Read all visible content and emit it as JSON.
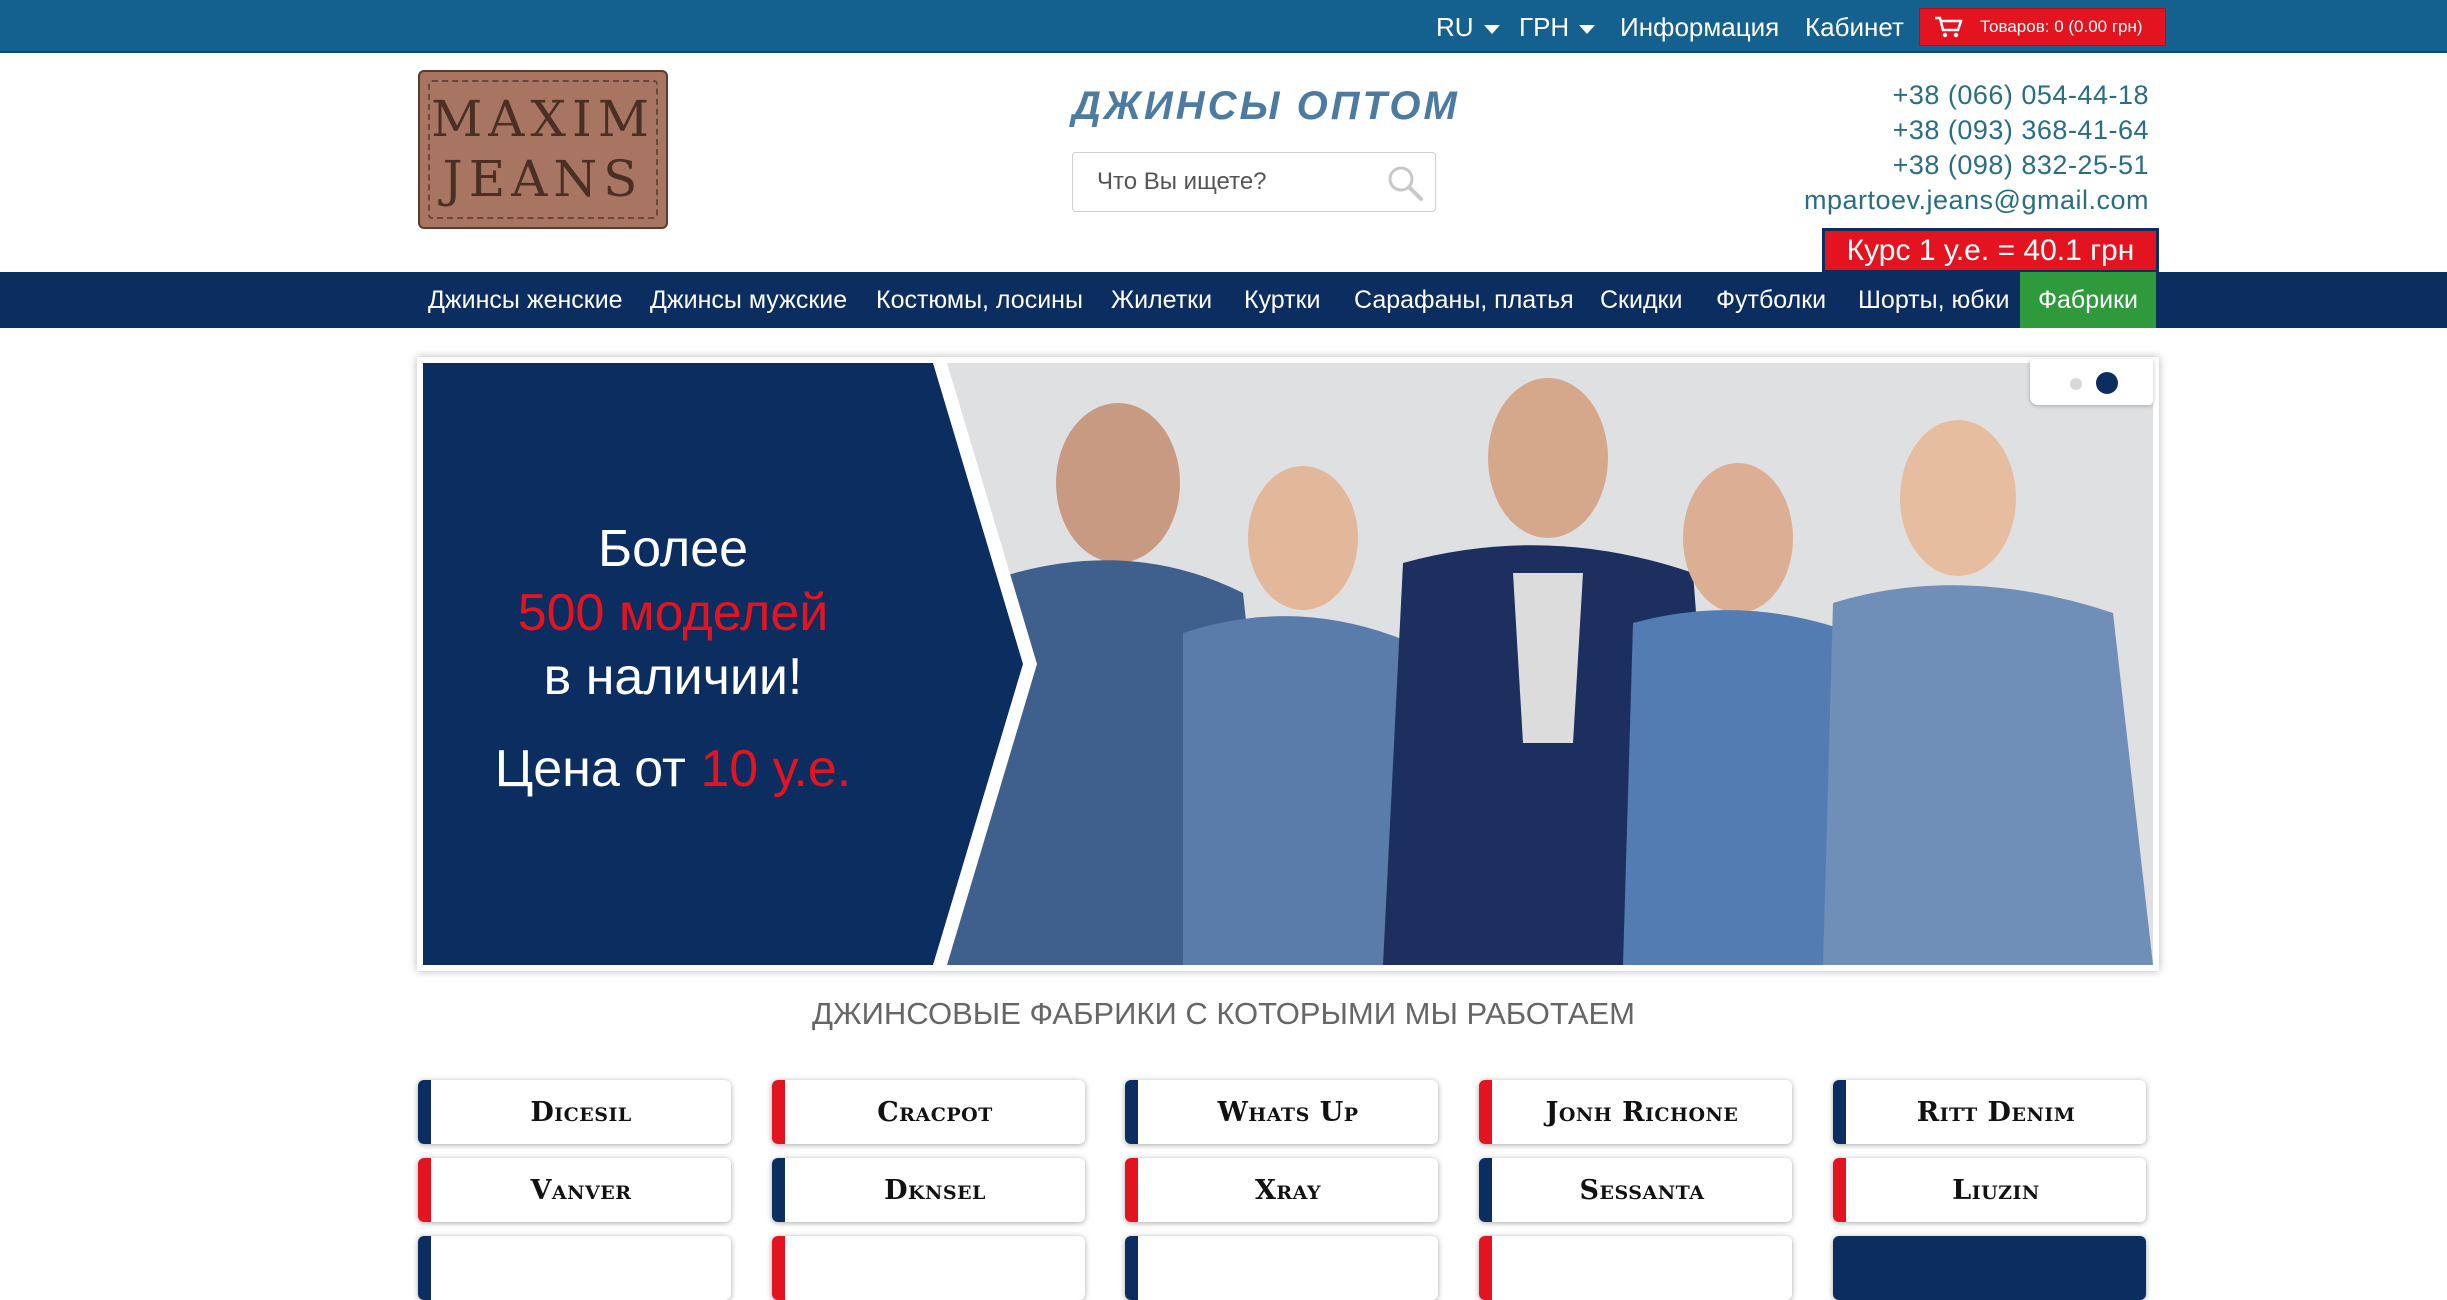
{
  "topbar": {
    "language": "RU",
    "currency": "ГРН",
    "info_link": "Информация",
    "cabinet_link": "Кабинет",
    "cart_text": "Товаров: 0 (0.00 грн)"
  },
  "header": {
    "logo_text": [
      "MAXIM",
      "JEANS"
    ],
    "site_title": "ДЖИНСЫ ОПТОМ",
    "search_placeholder": "Что Вы ищете?",
    "phones": [
      "+38 (066) 054-44-18",
      "+38 (093) 368-41-64",
      "+38 (098) 832-25-51"
    ],
    "email": "mpartoev.jeans@gmail.com",
    "rate": "Курс 1 у.е. = 40.1 грн"
  },
  "nav": {
    "items": [
      "Джинсы женские",
      "Джинсы мужские",
      "Костюмы, лосины",
      "Жилетки",
      "Куртки",
      "Сарафаны, платья",
      "Скидки",
      "Футболки",
      "Шорты, юбки",
      "Фабрики"
    ]
  },
  "banner": {
    "line1": "Более",
    "line2": "500 моделей",
    "line3": "в наличии!",
    "price_prefix": "Цена от",
    "price_value": "10 у.е.",
    "slides": 2,
    "active_slide": 2
  },
  "factories": {
    "title": "ДЖИНСОВЫЕ ФАБРИКИ С КОТОРЫМИ МЫ РАБОТАЕМ",
    "row1": [
      "Dicesil",
      "Cracpot",
      "Whats Up",
      "Jonh Richone",
      "Ritt Denim"
    ],
    "row2": [
      "Vanver",
      "Dknsel",
      "Xray",
      "Sessanta",
      "Liuzin"
    ]
  },
  "colors": {
    "top_bar": "#14608f",
    "nav": "#0c2d60",
    "accent_red": "#e3141f",
    "active_green": "#2e9a3c"
  }
}
